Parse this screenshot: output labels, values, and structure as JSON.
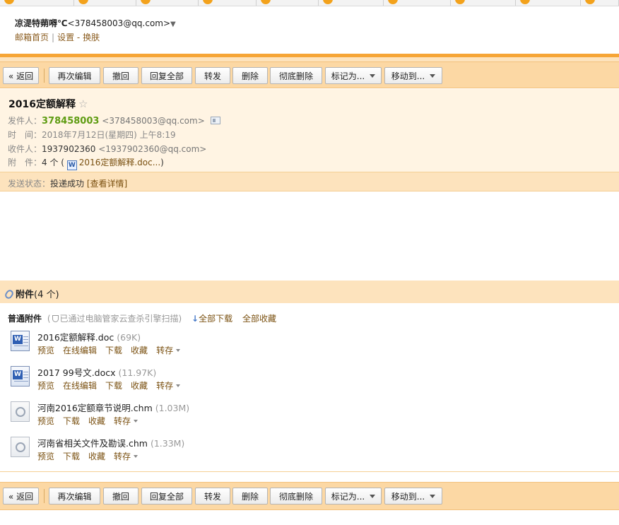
{
  "account": {
    "nickname": "凉湜特蒴嘚℃",
    "email": "<378458003@qq.com>",
    "caret": "▼",
    "links": {
      "home": "邮箱首页",
      "settings": "设置",
      "dash": "-",
      "skin": "换肤"
    }
  },
  "toolbar": {
    "back": "« 返回",
    "reedit": "再次编辑",
    "recall": "撤回",
    "reply_all": "回复全部",
    "forward": "转发",
    "delete": "删除",
    "delete_forever": "彻底删除",
    "mark_as": "标记为...",
    "move_to": "移动到..."
  },
  "mail": {
    "subject": "2016定额解释",
    "star": "☆",
    "from_label": "发件人：",
    "from_name": "378458003",
    "from_addr": "<378458003@qq.com>",
    "time_label": "时　间：",
    "time": "2018年7月12日(星期四) 上午8:19",
    "to_label": "收件人：",
    "to_name": "1937902360",
    "to_addr": "<1937902360@qq.com>",
    "att_label": "附　件：",
    "att_count": "4 个 (",
    "att_first": "2016定额解释.doc...",
    "att_close": ")",
    "status_label": "发送状态：",
    "status": "投递成功",
    "status_detail": "[查看详情]"
  },
  "attachments": {
    "title": "附件",
    "count": "(4 个)",
    "normal_label": "普通附件",
    "scan_open": "(",
    "scan_text": "已通过电脑管家云查杀引擎扫描)",
    "download_all": "全部下载",
    "save_all": "全部收藏",
    "items": [
      {
        "name": "2016定额解释.doc",
        "size": "(69K)",
        "type": "doc",
        "actions": [
          "预览",
          "在线编辑",
          "下载",
          "收藏",
          "转存"
        ]
      },
      {
        "name": "2017 99号文.docx",
        "size": "(11.97K)",
        "type": "doc",
        "actions": [
          "预览",
          "在线编辑",
          "下载",
          "收藏",
          "转存"
        ]
      },
      {
        "name": "河南2016定额章节说明.chm",
        "size": "(1.03M)",
        "type": "chm",
        "actions": [
          "预览",
          "下载",
          "收藏",
          "转存"
        ]
      },
      {
        "name": "河南省相关文件及勘误.chm",
        "size": "(1.33M)",
        "type": "chm",
        "actions": [
          "预览",
          "下载",
          "收藏",
          "转存"
        ]
      }
    ]
  },
  "colors": {
    "accent": "#f6a536",
    "toolbar_bg": "#fcd8a4",
    "header_bg": "#fff4e3",
    "sender": "#5e9c12"
  }
}
